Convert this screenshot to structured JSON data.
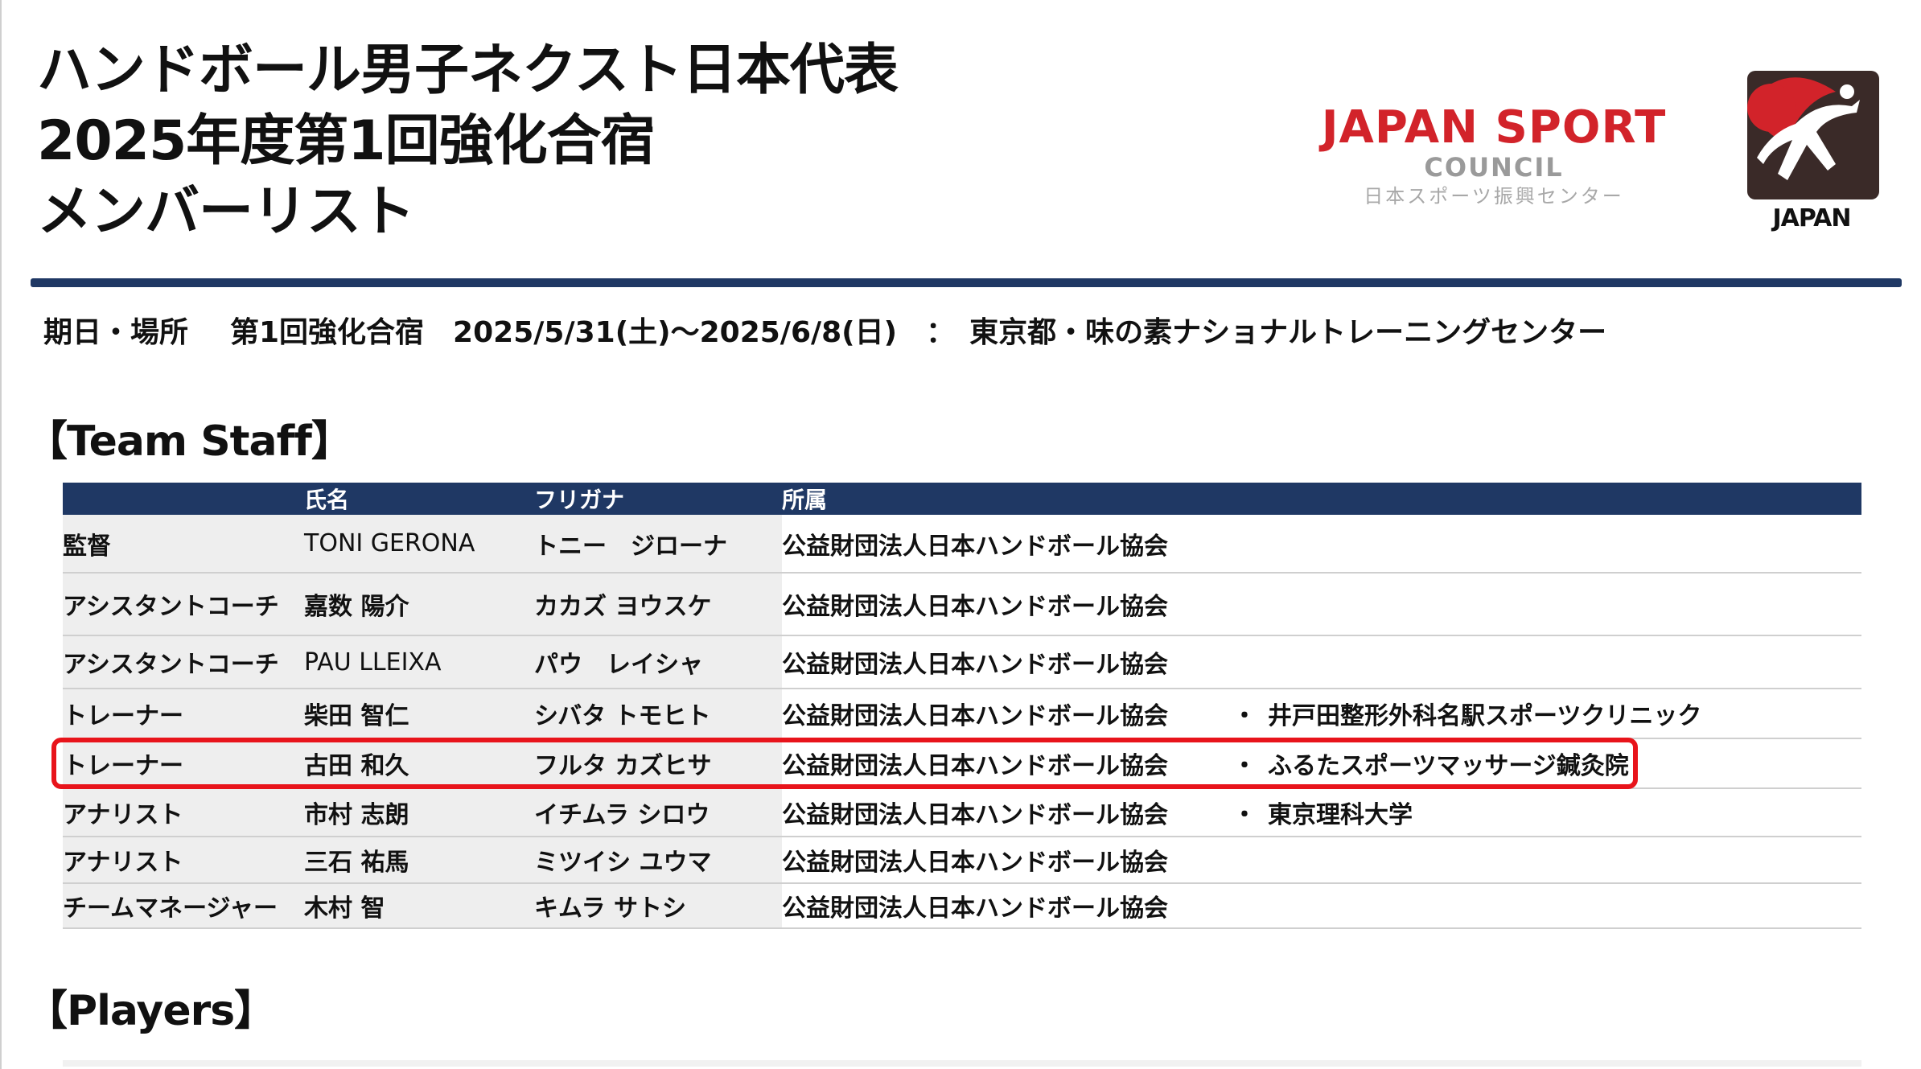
{
  "title": {
    "line1": "ハンドボール男子ネクスト日本代表",
    "line2": "2025年度第1回強化合宿",
    "line3": "メンバーリスト"
  },
  "jsc_logo": {
    "main": "JAPAN SPORT",
    "sub": "COUNCIL",
    "jp": "日本スポーツ振興センター",
    "color": "#d2232a"
  },
  "jha_logo": {
    "text": "JAPAN",
    "icon": "handball-player-icon"
  },
  "period": {
    "label": "期日・場所",
    "value": "第1回強化合宿　2025/5/31(土)～2025/6/8(日)　：　東京都・味の素ナショナルトレーニングセンター"
  },
  "sections": {
    "staff": "【Team Staff】",
    "players": "【Players】"
  },
  "staff_table": {
    "headers": [
      "",
      "氏名",
      "フリガナ",
      "所属",
      ""
    ],
    "rows": [
      {
        "role": "監督",
        "name": "TONI GERONA",
        "kana": "トニー　ジローナ",
        "org": "公益財団法人日本ハンドボール協会",
        "bullet": "",
        "extra": ""
      },
      {
        "role": "アシスタントコーチ",
        "name": "嘉数 陽介",
        "kana": "カカズ ヨウスケ",
        "org": "公益財団法人日本ハンドボール協会",
        "bullet": "",
        "extra": ""
      },
      {
        "role": "アシスタントコーチ",
        "name": "PAU LLEIXA",
        "kana": "パウ　レイシャ",
        "org": "公益財団法人日本ハンドボール協会",
        "bullet": "",
        "extra": ""
      },
      {
        "role": "トレーナー",
        "name": "柴田 智仁",
        "kana": "シバタ トモヒト",
        "org": "公益財団法人日本ハンドボール協会",
        "bullet": "・",
        "extra": "井戸田整形外科名駅スポーツクリニック"
      },
      {
        "role": "トレーナー",
        "name": "古田 和久",
        "kana": "フルタ カズヒサ",
        "org": "公益財団法人日本ハンドボール協会",
        "bullet": "・",
        "extra": "ふるたスポーツマッサージ鍼灸院"
      },
      {
        "role": "アナリスト",
        "name": "市村 志朗",
        "kana": "イチムラ シロウ",
        "org": "公益財団法人日本ハンドボール協会",
        "bullet": "・",
        "extra": "東京理科大学"
      },
      {
        "role": "アナリスト",
        "name": "三石 祐馬",
        "kana": "ミツイシ ユウマ",
        "org": "公益財団法人日本ハンドボール協会",
        "bullet": "",
        "extra": ""
      },
      {
        "role": "チームマネージャー",
        "name": "木村 智",
        "kana": "キムラ サトシ",
        "org": "公益財団法人日本ハンドボール協会",
        "bullet": "",
        "extra": ""
      }
    ]
  },
  "colors": {
    "navy": "#1f3864",
    "highlight": "#e8141b",
    "row_shade": "#eeeeee"
  }
}
